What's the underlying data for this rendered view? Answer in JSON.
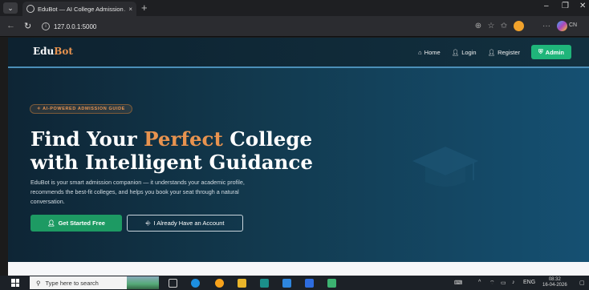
{
  "browser": {
    "tab_title": "EduBot — AI College Admission A",
    "tab_close": "×",
    "new_tab": "+",
    "url": "127.0.0.1:5000",
    "copilot_label": "CN"
  },
  "app": {
    "brand_part1": "Edu",
    "brand_part2": "Bot",
    "nav": {
      "home": "Home",
      "login": "Login",
      "register": "Register",
      "admin": "Admin"
    }
  },
  "hero": {
    "badge": "AI-POWERED ADMISSION GUIDE",
    "headline_line1_before": "Find Your ",
    "headline_line1_accent": "Perfect",
    "headline_line1_after": " College",
    "headline_line2": "with Intelligent Guidance",
    "description": "EduBot is your smart admission companion — it understands your academic profile, recommends the best-fit colleges, and helps you book your seat through a natural conversation.",
    "primary_button": "Get Started Free",
    "secondary_button": "I Already Have an Account"
  },
  "taskbar": {
    "search_placeholder": "Type here to search",
    "language": "ENG",
    "time": "08:32",
    "date": "16-04-2026"
  },
  "colors": {
    "accent": "#e8934f",
    "primary_green": "#1d9a63",
    "admin_green": "#1fb57a",
    "hero_dark": "#0e2535"
  }
}
